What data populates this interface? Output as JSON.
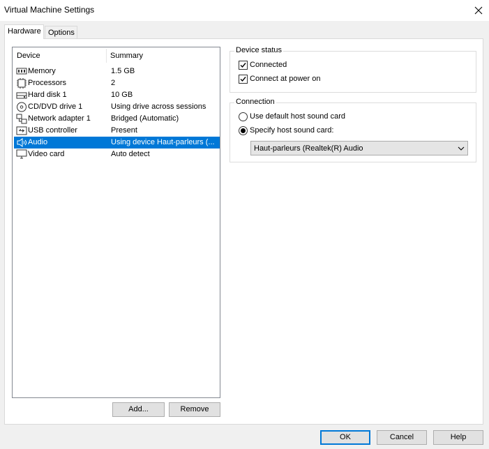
{
  "window": {
    "title": "Virtual Machine Settings"
  },
  "tabs": [
    {
      "label": "Hardware",
      "active": true
    },
    {
      "label": "Options",
      "active": false
    }
  ],
  "device_list": {
    "columns": [
      "Device",
      "Summary"
    ],
    "rows": [
      {
        "icon": "memory-icon",
        "name": "Memory",
        "summary": "1.5 GB",
        "selected": false
      },
      {
        "icon": "processor-icon",
        "name": "Processors",
        "summary": "2",
        "selected": false
      },
      {
        "icon": "hard-disk-icon",
        "name": "Hard disk 1",
        "summary": "10 GB",
        "selected": false
      },
      {
        "icon": "cd-dvd-icon",
        "name": "CD/DVD drive 1",
        "summary": "Using drive  across sessions",
        "selected": false
      },
      {
        "icon": "network-adapter-icon",
        "name": "Network adapter 1",
        "summary": "Bridged (Automatic)",
        "selected": false
      },
      {
        "icon": "usb-icon",
        "name": "USB controller",
        "summary": "Present",
        "selected": false
      },
      {
        "icon": "speaker-icon",
        "name": "Audio",
        "summary": "Using device Haut-parleurs (...",
        "selected": true
      },
      {
        "icon": "monitor-icon",
        "name": "Video card",
        "summary": "Auto detect",
        "selected": false
      }
    ],
    "add_label": "Add...",
    "remove_label": "Remove"
  },
  "device_status": {
    "title": "Device status",
    "connected": {
      "label": "Connected",
      "checked": true
    },
    "connect_at_power_on": {
      "label": "Connect at power on",
      "checked": true
    }
  },
  "connection": {
    "title": "Connection",
    "default_option": {
      "label": "Use default host sound card",
      "selected": false
    },
    "specify_option": {
      "label": "Specify host sound card:",
      "selected": true
    },
    "sound_card_value": "Haut-parleurs (Realtek(R) Audio"
  },
  "footer": {
    "ok_label": "OK",
    "cancel_label": "Cancel",
    "help_label": "Help"
  },
  "colors": {
    "selection": "#0078d7",
    "background": "#f0f0f0",
    "panel": "#ffffff"
  }
}
